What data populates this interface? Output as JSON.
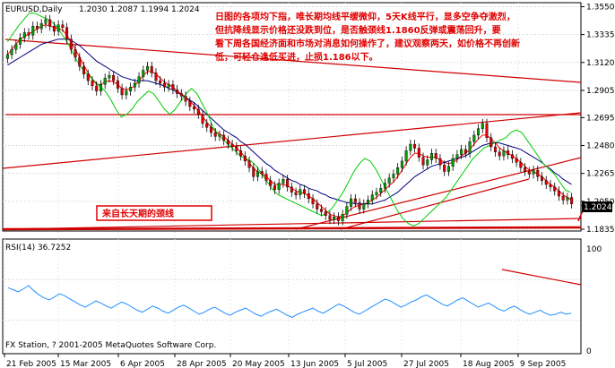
{
  "chart_data": [
    {
      "type": "candlestick",
      "symbol_header": "EURUSD,Daily",
      "ohlc_header": "1.2030 1.2087 1.1994 1.2024",
      "current_price_label": "1.2024",
      "ylim": [
        1.1835,
        1.356
      ],
      "y_ticks": [
        "1.3550",
        "1.3335",
        "1.3120",
        "1.2905",
        "1.2695",
        "1.2480",
        "1.2265",
        "1.2050",
        "1.1835"
      ],
      "x_tick_labels": [
        "21 Feb 2005",
        "15 Mar 2005",
        "6 Apr 2005",
        "28 Apr 2005",
        "20 May 2005",
        "13 Jun 2005",
        "5 Jul 2005",
        "27 Jul 2005",
        "18 Aug 2005",
        "9 Sep 2005"
      ],
      "closes": [
        1.318,
        1.322,
        1.326,
        1.331,
        1.335,
        1.333,
        1.34,
        1.338,
        1.342,
        1.345,
        1.34,
        1.336,
        1.341,
        1.339,
        1.33,
        1.322,
        1.316,
        1.309,
        1.303,
        1.298,
        1.294,
        1.29,
        1.295,
        1.3,
        1.302,
        1.298,
        1.292,
        1.287,
        1.29,
        1.293,
        1.296,
        1.301,
        1.306,
        1.309,
        1.304,
        1.298,
        1.296,
        1.293,
        1.295,
        1.291,
        1.288,
        1.286,
        1.282,
        1.278,
        1.276,
        1.272,
        1.265,
        1.262,
        1.258,
        1.255,
        1.256,
        1.252,
        1.249,
        1.247,
        1.244,
        1.24,
        1.236,
        1.231,
        1.224,
        1.228,
        1.226,
        1.221,
        1.217,
        1.214,
        1.219,
        1.222,
        1.216,
        1.212,
        1.21,
        1.214,
        1.211,
        1.207,
        1.203,
        1.199,
        1.197,
        1.194,
        1.191,
        1.193,
        1.19,
        1.195,
        1.201,
        1.207,
        1.204,
        1.199,
        1.203,
        1.206,
        1.21,
        1.212,
        1.215,
        1.219,
        1.223,
        1.226,
        1.231,
        1.236,
        1.244,
        1.249,
        1.246,
        1.239,
        1.233,
        1.237,
        1.242,
        1.238,
        1.233,
        1.228,
        1.232,
        1.238,
        1.241,
        1.245,
        1.242,
        1.251,
        1.256,
        1.261,
        1.265,
        1.254,
        1.247,
        1.243,
        1.24,
        1.244,
        1.241,
        1.238,
        1.235,
        1.231,
        1.228,
        1.226,
        1.229,
        1.224,
        1.221,
        1.218,
        1.216,
        1.213,
        1.209,
        1.206,
        1.208,
        1.203
      ],
      "series": [
        {
          "name": "",
          "color": "#ff0000",
          "values": [
            1.318,
            1.322,
            1.326,
            1.33,
            1.332,
            1.334,
            1.336,
            1.338,
            1.34,
            1.341,
            1.34,
            1.339,
            1.338,
            1.337,
            1.333,
            1.328,
            1.322,
            1.316,
            1.31,
            1.304,
            1.299,
            1.295,
            1.295,
            1.297,
            1.298,
            1.297,
            1.295,
            1.292,
            1.291,
            1.292,
            1.294,
            1.298,
            1.302,
            1.305,
            1.305,
            1.303,
            1.3,
            1.297,
            1.295,
            1.293,
            1.29,
            1.288,
            1.285,
            1.282,
            1.279,
            1.275,
            1.27,
            1.266,
            1.262,
            1.259,
            1.257,
            1.255,
            1.252,
            1.249,
            1.246,
            1.243,
            1.239,
            1.235,
            1.23,
            1.228,
            1.226,
            1.224,
            1.221,
            1.218,
            1.218,
            1.218,
            1.217,
            1.215,
            1.213,
            1.212,
            1.211,
            1.209,
            1.207,
            1.204,
            1.201,
            1.198,
            1.195,
            1.194,
            1.193,
            1.194,
            1.196,
            1.199,
            1.201,
            1.202,
            1.203,
            1.204,
            1.206,
            1.208,
            1.211,
            1.214,
            1.217,
            1.22,
            1.224,
            1.229,
            1.234,
            1.239,
            1.242,
            1.242,
            1.24,
            1.239,
            1.239,
            1.239,
            1.237,
            1.235,
            1.234,
            1.235,
            1.237,
            1.24,
            1.242,
            1.245,
            1.249,
            1.253,
            1.256,
            1.256,
            1.253,
            1.25,
            1.246,
            1.244,
            1.242,
            1.24,
            1.238,
            1.235,
            1.232,
            1.229,
            1.228,
            1.226,
            1.224,
            1.221,
            1.218,
            1.216,
            1.213,
            1.21,
            1.208,
            1.206
          ]
        },
        {
          "name": "",
          "color": "#000080",
          "values": [
            1.31,
            1.312,
            1.314,
            1.316,
            1.318,
            1.32,
            1.322,
            1.324,
            1.326,
            1.327,
            1.328,
            1.329,
            1.33,
            1.33,
            1.33,
            1.329,
            1.327,
            1.325,
            1.322,
            1.319,
            1.316,
            1.313,
            1.311,
            1.309,
            1.307,
            1.305,
            1.303,
            1.301,
            1.3,
            1.299,
            1.298,
            1.298,
            1.298,
            1.298,
            1.297,
            1.296,
            1.295,
            1.294,
            1.292,
            1.291,
            1.289,
            1.287,
            1.285,
            1.283,
            1.281,
            1.278,
            1.275,
            1.272,
            1.269,
            1.266,
            1.263,
            1.26,
            1.258,
            1.256,
            1.254,
            1.251,
            1.249,
            1.246,
            1.243,
            1.24,
            1.237,
            1.234,
            1.232,
            1.229,
            1.227,
            1.225,
            1.223,
            1.221,
            1.22,
            1.218,
            1.217,
            1.215,
            1.214,
            1.213,
            1.211,
            1.21,
            1.208,
            1.207,
            1.206,
            1.205,
            1.204,
            1.204,
            1.203,
            1.203,
            1.203,
            1.203,
            1.203,
            1.204,
            1.205,
            1.206,
            1.208,
            1.21,
            1.212,
            1.215,
            1.218,
            1.221,
            1.224,
            1.226,
            1.228,
            1.23,
            1.232,
            1.233,
            1.234,
            1.235,
            1.236,
            1.237,
            1.238,
            1.239,
            1.24,
            1.242,
            1.244,
            1.246,
            1.248,
            1.249,
            1.25,
            1.25,
            1.25,
            1.249,
            1.248,
            1.247,
            1.246,
            1.245,
            1.243,
            1.241,
            1.239,
            1.237,
            1.235,
            1.232,
            1.23,
            1.227,
            1.225,
            1.222,
            1.22,
            1.218
          ]
        },
        {
          "name": "",
          "color": "#00cc00",
          "values": [
            1.328,
            1.334,
            1.34,
            1.345,
            1.35,
            1.35,
            1.348,
            1.346,
            1.344,
            1.34,
            1.334,
            1.328,
            1.32,
            1.312,
            1.306,
            1.302,
            1.298,
            1.294,
            1.29,
            1.284,
            1.276,
            1.27,
            1.272,
            1.276,
            1.282,
            1.286,
            1.29,
            1.288,
            1.282,
            1.276,
            1.272,
            1.276,
            1.282,
            1.288,
            1.292,
            1.288,
            1.28,
            1.272,
            1.262,
            1.256,
            1.252,
            1.248,
            1.244,
            1.24,
            1.238,
            1.236,
            1.232,
            1.226,
            1.22,
            1.214,
            1.21,
            1.208,
            1.206,
            1.204,
            1.202,
            1.2,
            1.198,
            1.196,
            1.194,
            1.196,
            1.2,
            1.206,
            1.212,
            1.22,
            1.228,
            1.234,
            1.238,
            1.236,
            1.23,
            1.222,
            1.214,
            1.206,
            1.198,
            1.192,
            1.188,
            1.186,
            1.188,
            1.192,
            1.196,
            1.2,
            1.204,
            1.208,
            1.214,
            1.22,
            1.226,
            1.232,
            1.238,
            1.242,
            1.246,
            1.248,
            1.25,
            1.252,
            1.254,
            1.258,
            1.26,
            1.258,
            1.252,
            1.246,
            1.24,
            1.234,
            1.23,
            1.226,
            1.22,
            1.214,
            1.212
          ]
        }
      ],
      "annotation_text": "日图的各项均下指，唯长期均线平缓微仰，5天K线平行，显多空争夺激烈，但抗降线显示价格还没跌到位，是否触颈线1.1860反弹或震荡回升，要看下周各国经济面和市场对消息如何操作了，建议观察两天，如价格不再创新低，可轻仓逢低买进，止损1.186以下。",
      "neckline_label": "来自长天期的颈线"
    },
    {
      "type": "line",
      "title": "RSI(14) 36.7252",
      "ylim": [
        0,
        100
      ],
      "y_ticks": [
        "100",
        "0"
      ],
      "values": [
        62,
        60,
        58,
        61,
        64,
        59,
        55,
        52,
        50,
        53,
        56,
        54,
        51,
        48,
        45,
        43,
        46,
        49,
        47,
        44,
        42,
        45,
        48,
        46,
        43,
        40,
        38,
        41,
        44,
        42,
        39,
        37,
        40,
        43,
        45,
        42,
        39,
        36,
        38,
        41,
        43,
        40,
        37,
        35,
        38,
        40,
        42,
        39,
        36,
        34,
        37,
        39,
        41,
        38,
        35,
        33,
        36,
        38,
        40,
        42,
        39,
        37,
        40,
        43,
        46,
        44,
        41,
        38,
        36,
        39,
        42,
        45,
        48,
        51,
        49,
        46,
        43,
        45,
        48,
        50,
        53,
        55,
        52,
        49,
        46,
        44,
        47,
        50,
        52,
        49,
        46,
        43,
        45,
        47,
        44,
        41,
        39,
        42,
        44,
        41,
        38,
        36,
        38,
        40,
        37,
        35,
        36,
        38,
        36,
        37
      ],
      "footer": "FX Station, ? 2001-2005 MetaQuotes Software Corp."
    }
  ]
}
